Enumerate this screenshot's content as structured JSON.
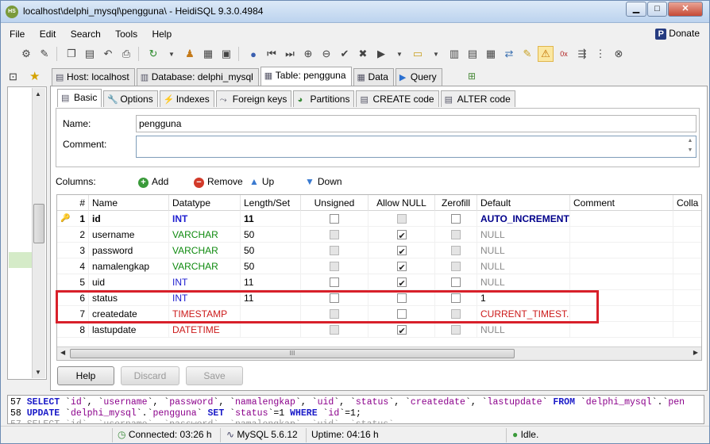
{
  "window": {
    "title": "localhost\\delphi_mysql\\pengguna\\ - HeidiSQL 9.3.0.4984",
    "app_icon_text": "HS",
    "minimize": "▁",
    "maximize": "□",
    "close": "✕"
  },
  "menu": [
    "File",
    "Edit",
    "Search",
    "Tools",
    "Help"
  ],
  "donate_label": "Donate",
  "toolbar_icons": [
    "connect-icon",
    "disconnect-icon",
    "copy-icon",
    "paste-icon",
    "undo-icon",
    "print-icon",
    "refresh-icon",
    "users-icon",
    "export-icon",
    "help-icon",
    "first-icon",
    "last-icon",
    "add-icon",
    "remove-icon",
    "apply-icon",
    "cancel-icon",
    "run-icon",
    "run-dropdown-icon",
    "explain-icon",
    "save-icon",
    "load-sql-icon",
    "query-builder-icon",
    "format-icon",
    "warning-icon",
    "clear-icon",
    "wrap-icon",
    "stop-icon"
  ],
  "main_tabs": [
    {
      "label": "Host: localhost",
      "icon": "host-icon"
    },
    {
      "label": "Database: delphi_mysql",
      "icon": "database-icon"
    },
    {
      "label": "Table: pengguna",
      "icon": "table-icon"
    },
    {
      "label": "Data",
      "icon": "data-icon"
    },
    {
      "label": "Query",
      "icon": "query-icon"
    }
  ],
  "sub_tabs": [
    "Basic",
    "Options",
    "Indexes",
    "Foreign keys",
    "Partitions",
    "CREATE code",
    "ALTER code"
  ],
  "form": {
    "name_label": "Name:",
    "name_value": "pengguna",
    "comment_label": "Comment:",
    "comment_value": ""
  },
  "columns_toolbar": {
    "label": "Columns:",
    "add": "Add",
    "remove": "Remove",
    "up": "Up",
    "down": "Down"
  },
  "grid_headers": [
    "#",
    "Name",
    "Datatype",
    "Length/Set",
    "Unsigned",
    "Allow NULL",
    "Zerofill",
    "Default",
    "Comment",
    "Colla"
  ],
  "grid_rows": [
    {
      "num": "1",
      "name": "id",
      "datatype": "INT",
      "type_color": "blue",
      "length": "11",
      "unsigned": "unchecked",
      "allow_null": "disabled",
      "zerofill": "unchecked",
      "default": "AUTO_INCREMENT",
      "default_color": "navy",
      "pk": true
    },
    {
      "num": "2",
      "name": "username",
      "datatype": "VARCHAR",
      "type_color": "green",
      "length": "50",
      "unsigned": "disabled",
      "allow_null": "checked",
      "zerofill": "disabled",
      "default": "NULL",
      "default_color": "gray",
      "pk": false
    },
    {
      "num": "3",
      "name": "password",
      "datatype": "VARCHAR",
      "type_color": "green",
      "length": "50",
      "unsigned": "disabled",
      "allow_null": "checked",
      "zerofill": "disabled",
      "default": "NULL",
      "default_color": "gray",
      "pk": false
    },
    {
      "num": "4",
      "name": "namalengkap",
      "datatype": "VARCHAR",
      "type_color": "green",
      "length": "50",
      "unsigned": "disabled",
      "allow_null": "checked",
      "zerofill": "disabled",
      "default": "NULL",
      "default_color": "gray",
      "pk": false
    },
    {
      "num": "5",
      "name": "uid",
      "datatype": "INT",
      "type_color": "blue",
      "length": "11",
      "unsigned": "unchecked",
      "allow_null": "checked",
      "zerofill": "unchecked",
      "default": "NULL",
      "default_color": "gray",
      "pk": false
    },
    {
      "num": "6",
      "name": "status",
      "datatype": "INT",
      "type_color": "blue",
      "length": "11",
      "unsigned": "unchecked",
      "allow_null": "unchecked",
      "zerofill": "unchecked",
      "default": "1",
      "default_color": "black",
      "pk": false
    },
    {
      "num": "7",
      "name": "createdate",
      "datatype": "TIMESTAMP",
      "type_color": "red",
      "length": "",
      "unsigned": "disabled",
      "allow_null": "unchecked",
      "zerofill": "disabled",
      "default": "CURRENT_TIMEST...",
      "default_color": "red",
      "pk": false
    },
    {
      "num": "8",
      "name": "lastupdate",
      "datatype": "DATETIME",
      "type_color": "red",
      "length": "",
      "unsigned": "disabled",
      "allow_null": "checked",
      "zerofill": "disabled",
      "default": "NULL",
      "default_color": "gray",
      "pk": false
    }
  ],
  "scroll_grip": "III",
  "buttons": {
    "help": "Help",
    "discard": "Discard",
    "save": "Save"
  },
  "sql_log": [
    {
      "line_no": "57",
      "parts": [
        [
          "kw",
          "SELECT"
        ],
        [
          "",
          "`"
        ],
        [
          "ident",
          "id"
        ],
        [
          "",
          "`, `"
        ],
        [
          "ident",
          "username"
        ],
        [
          "",
          "`, `"
        ],
        [
          "ident",
          "password"
        ],
        [
          "",
          "`, `"
        ],
        [
          "ident",
          "namalengkap"
        ],
        [
          "",
          "`, `"
        ],
        [
          "ident",
          "uid"
        ],
        [
          "",
          "`, `"
        ],
        [
          "ident",
          "status"
        ],
        [
          "",
          "`, `"
        ],
        [
          "ident",
          "createdate"
        ],
        [
          "",
          "`, `"
        ],
        [
          "ident",
          "lastupdate"
        ],
        [
          "",
          "` "
        ],
        [
          "kw",
          "FROM"
        ],
        [
          "",
          "`"
        ],
        [
          "ident",
          "delphi_mysql"
        ],
        [
          "",
          "`.`"
        ],
        [
          "ident",
          "pen"
        ]
      ]
    },
    {
      "line_no": "58",
      "parts": [
        [
          "kw",
          "UPDATE"
        ],
        [
          "",
          "`"
        ],
        [
          "ident",
          "delphi_mysql"
        ],
        [
          "",
          "`.`"
        ],
        [
          "ident",
          "pengguna"
        ],
        [
          "",
          "` "
        ],
        [
          "kw",
          "SET"
        ],
        [
          "",
          "`"
        ],
        [
          "ident",
          "status"
        ],
        [
          "",
          "`=1 "
        ],
        [
          "kw",
          "WHERE"
        ],
        [
          "",
          "`"
        ],
        [
          "ident",
          "id"
        ],
        [
          "",
          "`=1;"
        ]
      ]
    }
  ],
  "status_bar": {
    "connected": "Connected: 03:26 h",
    "server": "MySQL 5.6.12",
    "uptime": "Uptime: 04:16 h",
    "state": "Idle."
  }
}
